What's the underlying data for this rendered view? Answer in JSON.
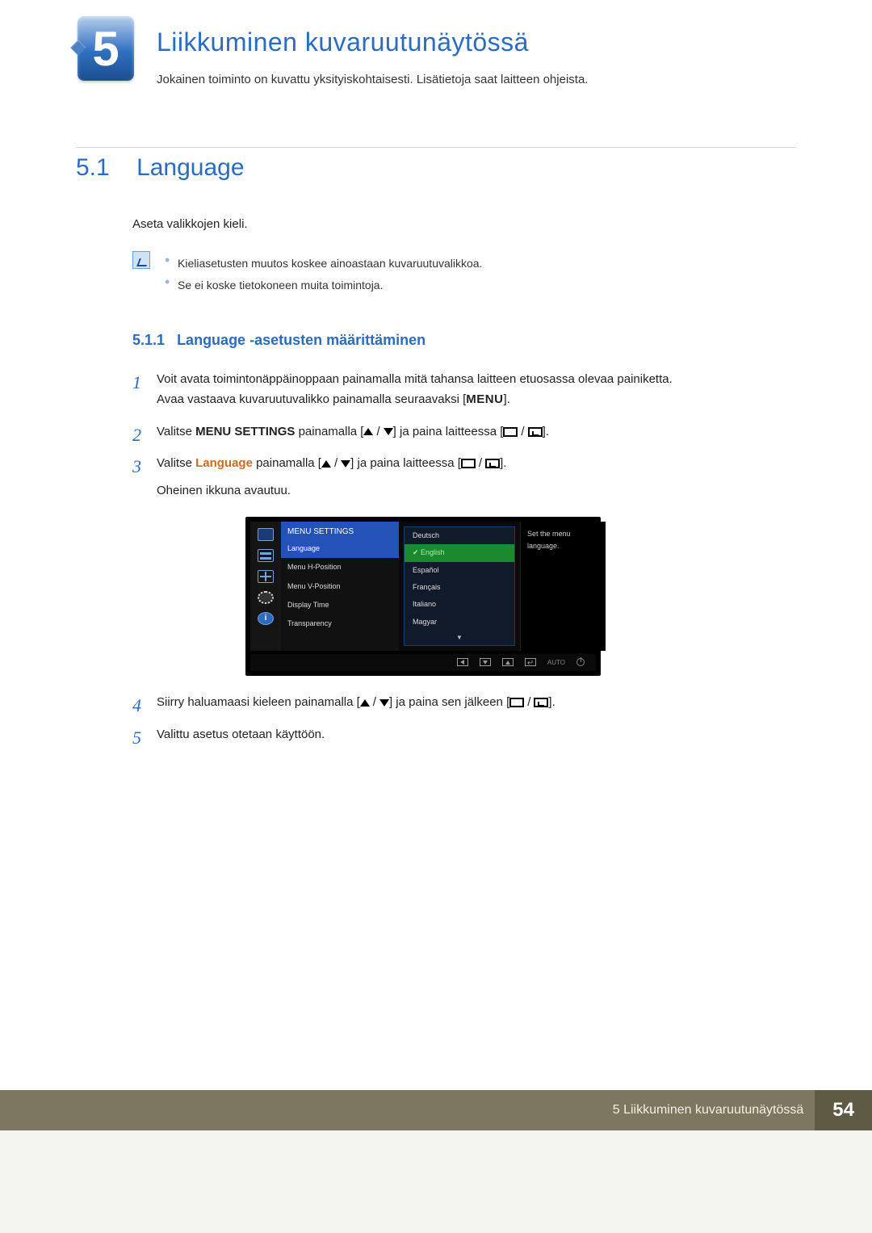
{
  "chapter": {
    "number": "5",
    "title": "Liikkuminen kuvaruutunäytössä",
    "desc": "Jokainen toiminto on kuvattu yksityiskohtaisesti. Lisätietoja saat laitteen ohjeista."
  },
  "section": {
    "number": "5.1",
    "title": "Language",
    "intro": "Aseta valikkojen kieli."
  },
  "notes": [
    "Kieliasetusten muutos koskee ainoastaan kuvaruutuvalikkoa.",
    "Se ei koske tietokoneen muita toimintoja."
  ],
  "subsection": {
    "number": "5.1.1",
    "title": "Language -asetusten määrittäminen"
  },
  "steps": {
    "s1a": "Voit avata toimintonäppäinoppaan painamalla mitä tahansa laitteen etuosassa olevaa painiketta.",
    "s1b_pre": "Avaa vastaava kuvaruutuvalikko painamalla seuraavaksi [",
    "s1b_btn": "MENU",
    "s1b_post": "].",
    "s2_pre": "Valitse ",
    "s2_kw": "MENU SETTINGS",
    "s2_mid": " painamalla [",
    "s2_mid2": "] ja paina laitteessa [",
    "s2_post": "].",
    "s3_pre": "Valitse ",
    "s3_kw": "Language",
    "s3_mid": " painamalla [",
    "s3_mid2": "] ja paina laitteessa [",
    "s3_post": "].",
    "s3_extra": "Oheinen ikkuna avautuu.",
    "s4_pre": "Siirry haluamaasi kieleen painamalla [",
    "s4_mid": "] ja paina sen jälkeen [",
    "s4_post": "].",
    "s5": "Valittu asetus otetaan käyttöön."
  },
  "osd": {
    "header": "MENU SETTINGS",
    "left": [
      "Language",
      "Menu H-Position",
      "Menu V-Position",
      "Display Time",
      "Transparency"
    ],
    "langs": [
      "Deutsch",
      "English",
      "Español",
      "Français",
      "Italiano",
      "Magyar"
    ],
    "hint1": "Set the menu",
    "hint2": "language.",
    "auto": "AUTO",
    "info_glyph": "i"
  },
  "footer": {
    "text": "5 Liikkuminen kuvaruutunäytössä",
    "page": "54"
  }
}
